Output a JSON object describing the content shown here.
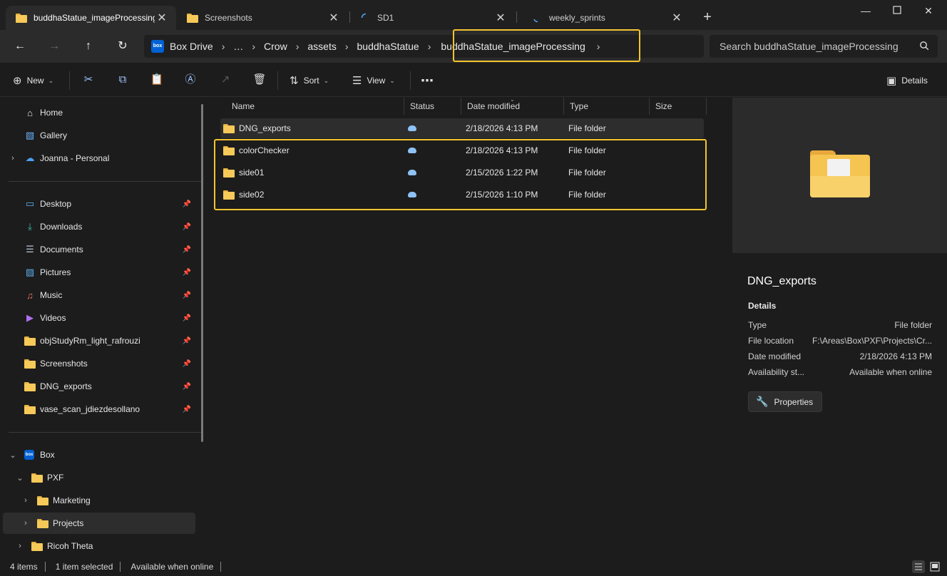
{
  "tabs": [
    {
      "label": "buddhaStatue_imageProcessing",
      "icon": "folder-icon",
      "active": true
    },
    {
      "label": "Screenshots",
      "icon": "folder-icon",
      "active": false
    },
    {
      "label": "SD1",
      "icon": "loading-icon",
      "active": false
    },
    {
      "label": "weekly_sprints",
      "icon": "loading-icon",
      "active": false
    }
  ],
  "address": {
    "crumbs": [
      "Box Drive",
      "…",
      "Crow",
      "assets",
      "buddhaStatue",
      "buddhaStatue_imageProcessing"
    ],
    "search_placeholder": "Search buddhaStatue_imageProcessing"
  },
  "toolbar": {
    "new_label": "New",
    "sort_label": "Sort",
    "view_label": "View",
    "details_label": "Details"
  },
  "sidebar": {
    "quick": [
      {
        "label": "Home",
        "icon": "home-icon"
      },
      {
        "label": "Gallery",
        "icon": "gallery-icon"
      },
      {
        "label": "Joanna - Personal",
        "icon": "onedrive-cloud-icon"
      }
    ],
    "pinned": [
      {
        "label": "Desktop",
        "icon": "desktop-icon"
      },
      {
        "label": "Downloads",
        "icon": "download-icon"
      },
      {
        "label": "Documents",
        "icon": "documents-icon"
      },
      {
        "label": "Pictures",
        "icon": "pictures-icon"
      },
      {
        "label": "Music",
        "icon": "music-icon"
      },
      {
        "label": "Videos",
        "icon": "videos-icon"
      },
      {
        "label": "objStudyRm_light_rafrouzi",
        "icon": "folder-icon"
      },
      {
        "label": "Screenshots",
        "icon": "folder-icon"
      },
      {
        "label": "DNG_exports",
        "icon": "folder-icon"
      },
      {
        "label": "vase_scan_jdiezdesollano",
        "icon": "folder-icon"
      }
    ],
    "tree": [
      {
        "label": "Box",
        "icon": "box-icon"
      },
      {
        "label": "PXF",
        "icon": "folder-icon"
      },
      {
        "label": "Marketing",
        "icon": "folder-icon"
      },
      {
        "label": "Projects",
        "icon": "folder-icon"
      },
      {
        "label": "Ricoh Theta",
        "icon": "folder-icon"
      }
    ]
  },
  "columns": [
    "Name",
    "Status",
    "Date modified",
    "Type",
    "Size"
  ],
  "files": [
    {
      "name": "DNG_exports",
      "status": "cloud",
      "date": "2/18/2026 4:13 PM",
      "type": "File folder",
      "size": ""
    },
    {
      "name": "colorChecker",
      "status": "cloud",
      "date": "2/18/2026 4:13 PM",
      "type": "File folder",
      "size": ""
    },
    {
      "name": "side01",
      "status": "cloud",
      "date": "2/15/2026 1:22 PM",
      "type": "File folder",
      "size": ""
    },
    {
      "name": "side02",
      "status": "cloud",
      "date": "2/15/2026 1:10 PM",
      "type": "File folder",
      "size": ""
    }
  ],
  "details": {
    "title": "DNG_exports",
    "section": "Details",
    "rows": [
      {
        "key": "Type",
        "value": "File folder"
      },
      {
        "key": "File location",
        "value": "F:\\Areas\\Box\\PXF\\Projects\\Cr..."
      },
      {
        "key": "Date modified",
        "value": "2/18/2026 4:13 PM"
      },
      {
        "key": "Availability st...",
        "value": "Available when online"
      }
    ],
    "properties_label": "Properties"
  },
  "status": {
    "items": "4 items",
    "selected": "1 item selected",
    "availability": "Available when online"
  },
  "colors": {
    "highlight": "#f4c430",
    "folder": "#f6c959",
    "box_brand": "#0061d5",
    "cloud": "#8ec2f5"
  }
}
